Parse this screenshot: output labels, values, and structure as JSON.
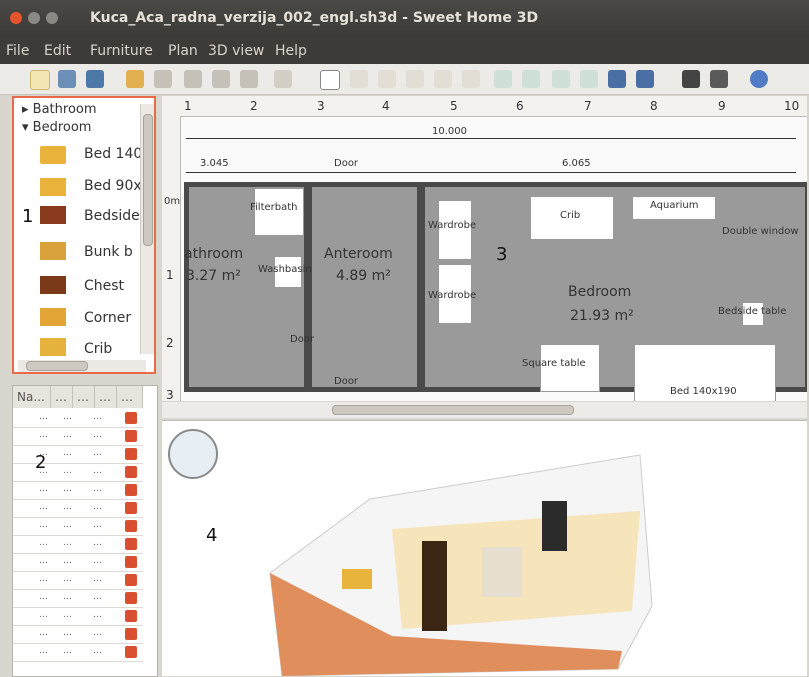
{
  "window": {
    "title": "Kuca_Aca_radna_verzija_002_engl.sh3d - Sweet Home 3D"
  },
  "menu": [
    "File",
    "Edit",
    "Furniture",
    "Plan",
    "3D view",
    "Help"
  ],
  "catalog": {
    "categories": [
      "Bathroom",
      "Bedroom"
    ],
    "items": [
      "Bed 140",
      "Bed 90x",
      "Bedside",
      "Bunk b",
      "Chest",
      "Corner",
      "Crib"
    ]
  },
  "furniture_table": {
    "header": "Na..."
  },
  "plan": {
    "ruler_x": [
      "1",
      "2",
      "3",
      "4",
      "5",
      "6",
      "7",
      "8",
      "9",
      "10"
    ],
    "ruler_y": [
      "0m",
      "1",
      "2",
      "3"
    ],
    "dims": {
      "total": "10.000",
      "left": "3.045",
      "door": "Door",
      "right": "6.065"
    },
    "rooms": [
      {
        "name": "athroom",
        "area": "3.27 m²"
      },
      {
        "name": "Anteroom",
        "area": "4.89 m²"
      },
      {
        "name": "Bedroom",
        "area": "21.93 m²"
      }
    ],
    "labels": {
      "filterbath": "Filterbath",
      "washbasin": "Washbasin",
      "door": "Door",
      "door2": "Door",
      "wardrobe1": "Wardrobe",
      "wardrobe2": "Wardrobe",
      "crib": "Crib",
      "aquarium": "Aquarium",
      "doublewin": "Double window",
      "bedside_table": "Bedside table",
      "square_table": "Square table",
      "bed": "Bed 140x190"
    }
  },
  "annotations": {
    "p1": "1",
    "p2": "2",
    "p3": "3",
    "p4": "4"
  },
  "colors": {
    "accent_border": "#e86a47",
    "titlebar": "#3b3a37",
    "room_fill": "#9a9a9a",
    "wall": "#4a4a4a"
  }
}
